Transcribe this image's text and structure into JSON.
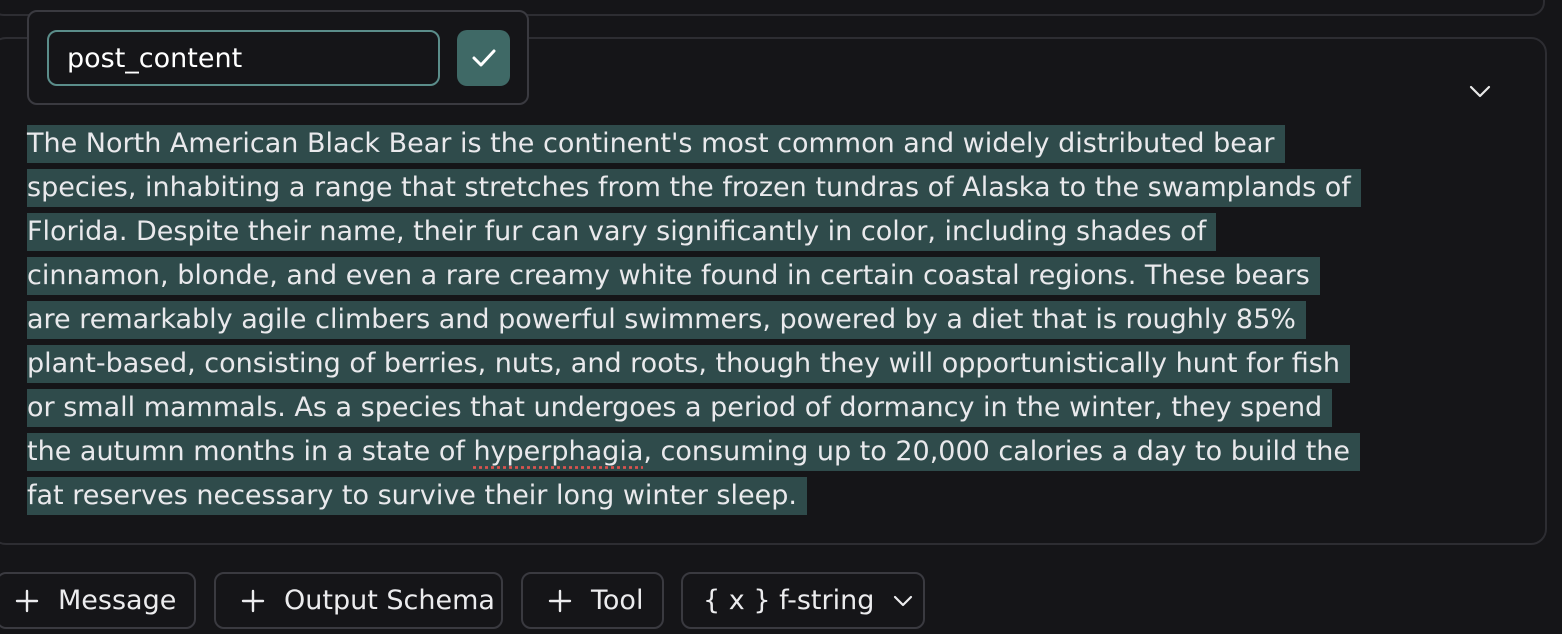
{
  "rename_popover": {
    "input_value": "post_content",
    "confirm_icon": "check-icon"
  },
  "message": {
    "collapse_icon": "chevron-down-icon",
    "lines": [
      "The North American Black Bear is the continent's most common and widely distributed bear",
      "species, inhabiting a range that stretches from the frozen tundras of Alaska to the swamplands of",
      "Florida. Despite their name, their fur can vary significantly in color, including shades of",
      "cinnamon, blonde, and even a rare creamy white found in certain coastal regions. These bears",
      "are remarkably agile climbers and powerful swimmers, powered by a diet that is roughly 85%",
      "plant-based, consisting of berries, nuts, and roots, though they will opportunistically hunt for fish",
      "or small mammals. As a species that undergoes a period of dormancy in the winter, they spend",
      "the autumn months in a state of ",
      "fat reserves necessary to survive their long winter sleep."
    ],
    "misspelled_word": "hyperphagia",
    "line8_tail": ", consuming up to 20,000 calories a day to build the"
  },
  "toolbar": {
    "message_label": "Message",
    "output_schema_label": "Output Schema",
    "tool_label": "Tool",
    "format_label": "{ x } f-string"
  },
  "colors": {
    "accent": "#3f6966",
    "highlight": "#2f4b4b",
    "background": "#151518"
  }
}
